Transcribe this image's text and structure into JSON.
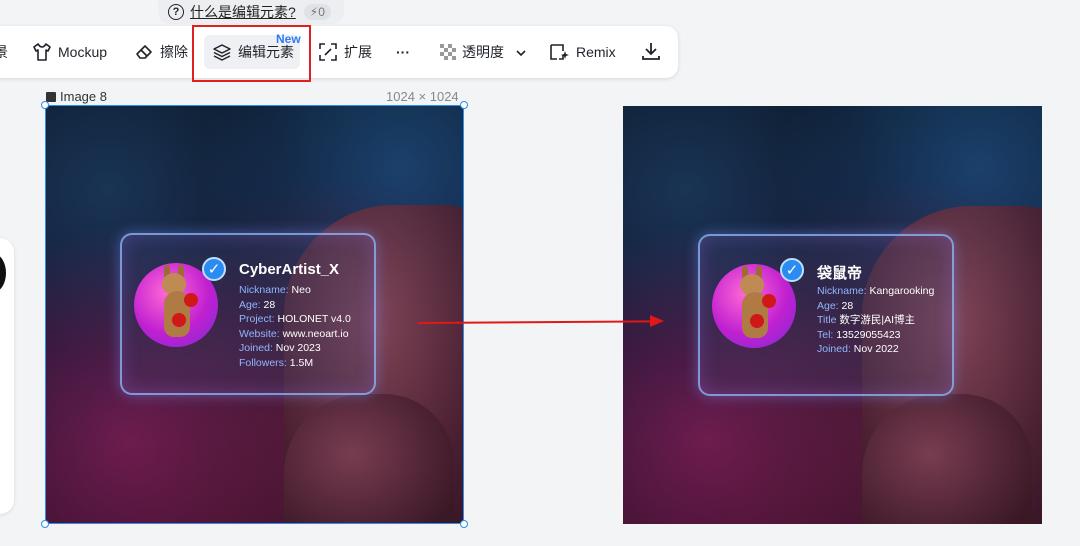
{
  "help": {
    "question": "什么是编辑元素?",
    "credits": "0"
  },
  "toolbar": {
    "partial_label": "景",
    "mockup_label": "Mockup",
    "erase_label": "擦除",
    "edit_elements_label": "编辑元素",
    "new_badge": "New",
    "expand_label": "扩展",
    "more_label": "···",
    "transparency_label": "透明度",
    "remix_label": "Remix"
  },
  "canvas": {
    "image_name": "Image 8",
    "image_size": "1024 × 1024"
  },
  "left_card": {
    "title": "CyberArtist_X",
    "lines": [
      {
        "key": "Nickname:",
        "value": "Neo"
      },
      {
        "key": "Age:",
        "value": "28"
      },
      {
        "key": "Project:",
        "value": "HOLONET v4.0"
      },
      {
        "key": "Website:",
        "value": "www.neoart.io"
      },
      {
        "key": "Joined:",
        "value": "Nov 2023"
      },
      {
        "key": "Followers:",
        "value": "1.5M"
      }
    ]
  },
  "right_card": {
    "title": "袋鼠帝",
    "lines": [
      {
        "key": "Nickname:",
        "value": "Kangarooking"
      },
      {
        "key": "Age:",
        "value": "28"
      },
      {
        "key": "Title",
        "value": "数字游民|AI博主"
      },
      {
        "key": "Tel:",
        "value": "13529055423"
      },
      {
        "key": "Joined:",
        "value": "Nov 2022"
      }
    ]
  },
  "colors": {
    "accent": "#2b8ef0",
    "highlight_red": "#e02020",
    "new_badge": "#2f7bf6",
    "card_key": "#8fb6ff"
  }
}
